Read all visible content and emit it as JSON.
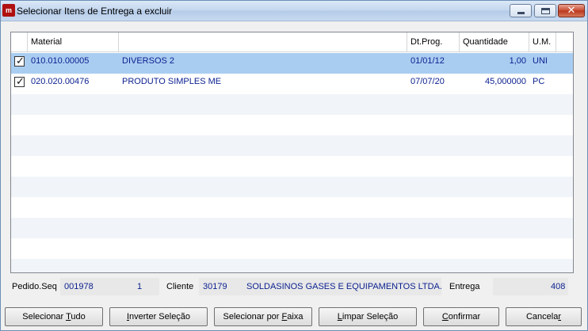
{
  "window": {
    "title": "Selecionar Itens de Entrega a excluir",
    "icon": "app-logo-icon"
  },
  "grid": {
    "columns": [
      "",
      "Material",
      "",
      "Dt.Prog.",
      "Quantidade",
      "U.M."
    ],
    "rows": [
      {
        "checked": true,
        "material": "010.010.00005",
        "descricao": "DIVERSOS 2",
        "dtprog": "01/01/12",
        "quantidade": "1,00",
        "um": "UNI",
        "selected": true
      },
      {
        "checked": true,
        "material": "020.020.00476",
        "descricao": "PRODUTO SIMPLES ME",
        "dtprog": "07/07/20",
        "quantidade": "45,000000",
        "um": "PC",
        "selected": false
      }
    ]
  },
  "info": {
    "pedido_label": "Pedido.Seq",
    "pedido": "001978",
    "seq": "1",
    "cliente_label": "Cliente",
    "cliente_codigo": "30179",
    "cliente_nome": "SOLDASINOS GASES E EQUIPAMENTOS LTDA.",
    "entrega_label": "Entrega",
    "entrega": "408"
  },
  "buttons": {
    "selecionar_tudo": {
      "pre": "Selecionar ",
      "hot": "T",
      "post": "udo"
    },
    "inverter": {
      "pre": "",
      "hot": "I",
      "post": "nverter Seleção"
    },
    "faixa": {
      "pre": "Selecionar por ",
      "hot": "F",
      "post": "aixa"
    },
    "limpar": {
      "pre": "",
      "hot": "L",
      "post": "impar Seleção"
    },
    "confirmar": {
      "pre": "",
      "hot": "C",
      "post": "onfirmar"
    },
    "cancelar": {
      "pre": "Cancela",
      "hot": "r",
      "post": ""
    }
  },
  "colors": {
    "value_text": "#0a1f8f",
    "selected_row": "#a9cdf1",
    "close_button": "#c64a2f"
  }
}
